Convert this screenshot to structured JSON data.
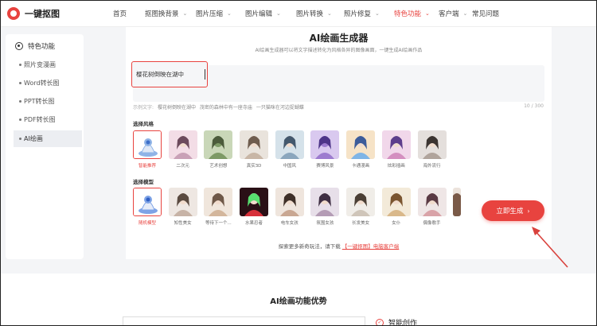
{
  "brand": {
    "name": "一键抠图",
    "accent": "#e8433f"
  },
  "nav": {
    "items": [
      {
        "label": "首页",
        "dropdown": false,
        "active": false
      },
      {
        "label": "抠图换背景",
        "dropdown": true,
        "active": false
      },
      {
        "label": "图片压缩",
        "dropdown": true,
        "active": false
      },
      {
        "label": "图片编辑",
        "dropdown": true,
        "active": false
      },
      {
        "label": "图片转换",
        "dropdown": true,
        "active": false
      },
      {
        "label": "照片修复",
        "dropdown": true,
        "active": false
      },
      {
        "label": "特色功能",
        "dropdown": true,
        "active": true
      },
      {
        "label": "客户端",
        "dropdown": true,
        "active": false
      },
      {
        "label": "常见问题",
        "dropdown": false,
        "active": false
      }
    ]
  },
  "sidebar": {
    "header": "特色功能",
    "items": [
      {
        "label": "照片变漫画",
        "active": false
      },
      {
        "label": "Word转长图",
        "active": false
      },
      {
        "label": "PPT转长图",
        "active": false
      },
      {
        "label": "PDF转长图",
        "active": false
      },
      {
        "label": "AI绘画",
        "active": true
      }
    ]
  },
  "main": {
    "title": "AI绘画生成器",
    "subtitle": "AI绘画生成器可以将文字描述转化为风格各异的图像画面，一键生成AI绘画作品",
    "prompt": {
      "value": "樱花树倒映在湖中"
    },
    "examples_label": "示例文字:",
    "examples": [
      "樱花树倒映在湖中",
      "茂密的森林中有一座寺庙",
      "一只猫咪在河边捉蝴蝶"
    ],
    "counter": "10 / 300",
    "style_label": "选择风格",
    "styles": [
      {
        "label": "智能推荐",
        "selected": true
      },
      {
        "label": "二次元",
        "selected": false
      },
      {
        "label": "艺术创想",
        "selected": false
      },
      {
        "label": "真实3D",
        "selected": false
      },
      {
        "label": "中国风",
        "selected": false
      },
      {
        "label": "赛博风景",
        "selected": false
      },
      {
        "label": "卡通漫画",
        "selected": false
      },
      {
        "label": "炫彩插画",
        "selected": false
      },
      {
        "label": "海外流行",
        "selected": false
      }
    ],
    "model_label": "选择模型",
    "models": [
      {
        "label": "随机模型",
        "selected": true
      },
      {
        "label": "知性美女",
        "selected": false
      },
      {
        "label": "等待下一个...",
        "selected": false
      },
      {
        "label": "水果忍者",
        "selected": false
      },
      {
        "label": "电车女孩",
        "selected": false
      },
      {
        "label": "氛围女孩",
        "selected": false
      },
      {
        "label": "长发美女",
        "selected": false
      },
      {
        "label": "女仆",
        "selected": false
      },
      {
        "label": "偶像歌手",
        "selected": false
      }
    ],
    "generate_label": "立即生成",
    "footer_text": "探索更多新奇玩法，请下载",
    "footer_link": "【一键抠图】电脑客户端"
  },
  "advantages": {
    "title": "AI绘画功能优势",
    "feature_label": "智能创作"
  }
}
